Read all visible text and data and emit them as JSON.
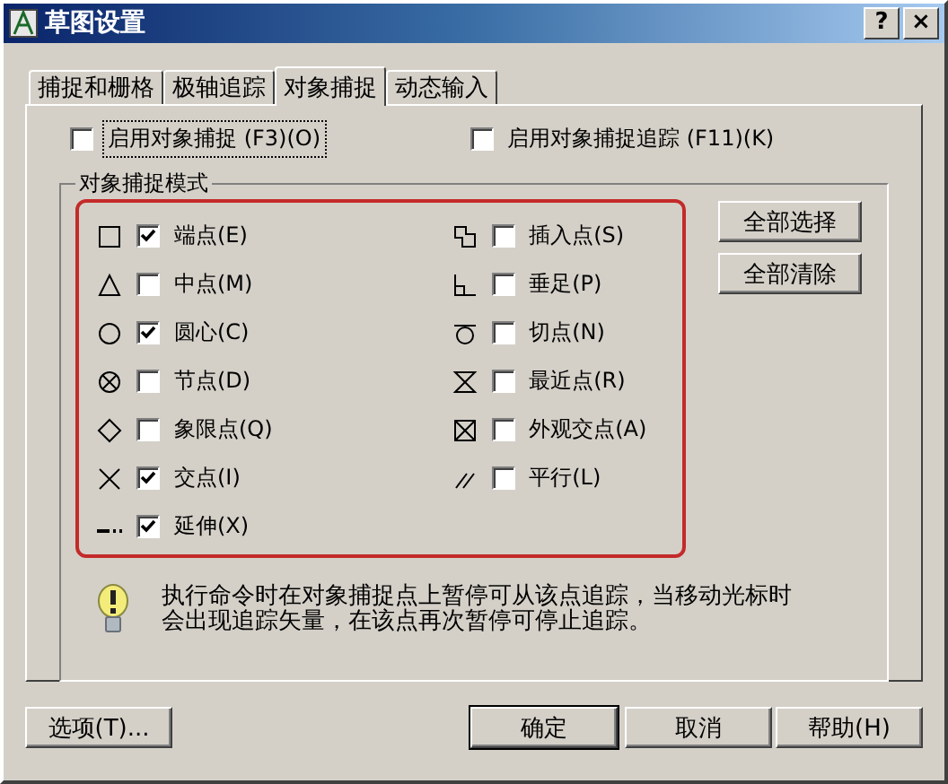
{
  "window": {
    "title": "草图设置",
    "help_button": "?",
    "close_button": "×"
  },
  "tabs": [
    {
      "label": "捕捉和栅格",
      "selected": false
    },
    {
      "label": "极轴追踪",
      "selected": false
    },
    {
      "label": "对象捕捉",
      "selected": true
    },
    {
      "label": "动态输入",
      "selected": false
    }
  ],
  "options": [
    {
      "label": "启用对象捕捉 (F3)(O)",
      "checked": false,
      "focused": true
    },
    {
      "label": "启用对象捕捉追踪 (F11)(K)",
      "checked": false,
      "focused": false
    }
  ],
  "snap_modes": {
    "title": "对象捕捉模式",
    "columns": [
      [
        {
          "kind": "endpoint",
          "label": "端点(E)",
          "checked": true
        },
        {
          "kind": "midpoint",
          "label": "中点(M)",
          "checked": false
        },
        {
          "kind": "center",
          "label": "圆心(C)",
          "checked": true
        },
        {
          "kind": "node",
          "label": "节点(D)",
          "checked": false
        },
        {
          "kind": "quadrant",
          "label": "象限点(Q)",
          "checked": false
        },
        {
          "kind": "intersection",
          "label": "交点(I)",
          "checked": true
        },
        {
          "kind": "extension",
          "label": "延伸(X)",
          "checked": true
        }
      ],
      [
        {
          "kind": "insertion",
          "label": "插入点(S)",
          "checked": false
        },
        {
          "kind": "perpendicular",
          "label": "垂足(P)",
          "checked": false
        },
        {
          "kind": "tangent",
          "label": "切点(N)",
          "checked": false
        },
        {
          "kind": "nearest",
          "label": "最近点(R)",
          "checked": false
        },
        {
          "kind": "apparent",
          "label": "外观交点(A)",
          "checked": false
        },
        {
          "kind": "parallel",
          "label": "平行(L)",
          "checked": false
        }
      ]
    ],
    "buttons": [
      "全部选择",
      "全部清除"
    ]
  },
  "hint": "执行命令时在对象捕捉点上暂停可从该点追踪，当移动光标时会出现追踪矢量，在该点再次暂停可停止追踪。",
  "footer": {
    "options_button": "选项(T)...",
    "ok_button": "确定",
    "cancel_button": "取消",
    "help_button": "帮助(H)"
  }
}
